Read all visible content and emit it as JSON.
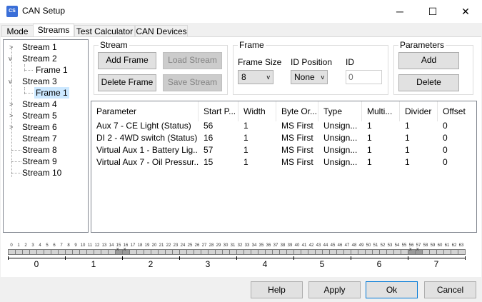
{
  "window": {
    "title": "CAN Setup",
    "icon": "app-icon",
    "minimize": "─",
    "maximize": "☐",
    "close": "✕"
  },
  "tabs": [
    "Mode",
    "Streams",
    "Test Calculator",
    "CAN Devices"
  ],
  "tree": {
    "items": [
      {
        "label": "Stream 1"
      },
      {
        "label": "Stream 2"
      },
      {
        "label": "Frame 1"
      },
      {
        "label": "Stream 3"
      },
      {
        "label": "Frame 1"
      },
      {
        "label": "Stream 4"
      },
      {
        "label": "Stream 5"
      },
      {
        "label": "Stream 6"
      },
      {
        "label": "Stream 7"
      },
      {
        "label": "Stream 8"
      },
      {
        "label": "Stream 9"
      },
      {
        "label": "Stream 10"
      }
    ],
    "selected": "Frame 1"
  },
  "stream_group": {
    "title": "Stream",
    "add_frame": "Add Frame",
    "load_stream": "Load Stream",
    "delete_frame": "Delete Frame",
    "save_stream": "Save Stream"
  },
  "frame_group": {
    "title": "Frame",
    "frame_size_label": "Frame Size",
    "frame_size_value": "8",
    "id_position_label": "ID Position",
    "id_position_value": "None",
    "id_label": "ID",
    "id_value": "0"
  },
  "parameters_group": {
    "title": "Parameters",
    "add": "Add",
    "delete": "Delete"
  },
  "grid": {
    "headers": [
      "Parameter",
      "Start P...",
      "Width",
      "Byte Or...",
      "Type",
      "Multi...",
      "Divider",
      "Offset"
    ],
    "rows": [
      [
        "Aux 7 - CE Light (Status)",
        "56",
        "1",
        "MS First",
        "Unsign...",
        "1",
        "1",
        "0"
      ],
      [
        "DI 2 - 4WD switch (Status)",
        "16",
        "1",
        "MS First",
        "Unsign...",
        "1",
        "1",
        "0"
      ],
      [
        "Virtual Aux 1 - Battery Lig...",
        "57",
        "1",
        "MS First",
        "Unsign...",
        "1",
        "1",
        "0"
      ],
      [
        "Virtual Aux 7 - Oil Pressur...",
        "15",
        "1",
        "MS First",
        "Unsign...",
        "1",
        "1",
        "0"
      ]
    ]
  },
  "bitmap": {
    "bit_labels": [
      "0",
      "1",
      "2",
      "3",
      "4",
      "5",
      "6",
      "7",
      "8",
      "9",
      "10",
      "11",
      "12",
      "13",
      "14",
      "15",
      "16",
      "17",
      "18",
      "19",
      "20",
      "21",
      "22",
      "23",
      "24",
      "25",
      "26",
      "27",
      "28",
      "29",
      "30",
      "31",
      "32",
      "33",
      "34",
      "35",
      "36",
      "37",
      "38",
      "39",
      "40",
      "41",
      "42",
      "43",
      "44",
      "45",
      "46",
      "47",
      "48",
      "49",
      "50",
      "51",
      "52",
      "53",
      "54",
      "55",
      "56",
      "57",
      "58",
      "59",
      "60",
      "61",
      "62",
      "63"
    ],
    "used_bits": [
      15,
      16,
      56,
      57
    ],
    "byte_labels": [
      "0",
      "1",
      "2",
      "3",
      "4",
      "5",
      "6",
      "7"
    ]
  },
  "footer": {
    "help": "Help",
    "apply": "Apply",
    "ok": "Ok",
    "cancel": "Cancel"
  }
}
